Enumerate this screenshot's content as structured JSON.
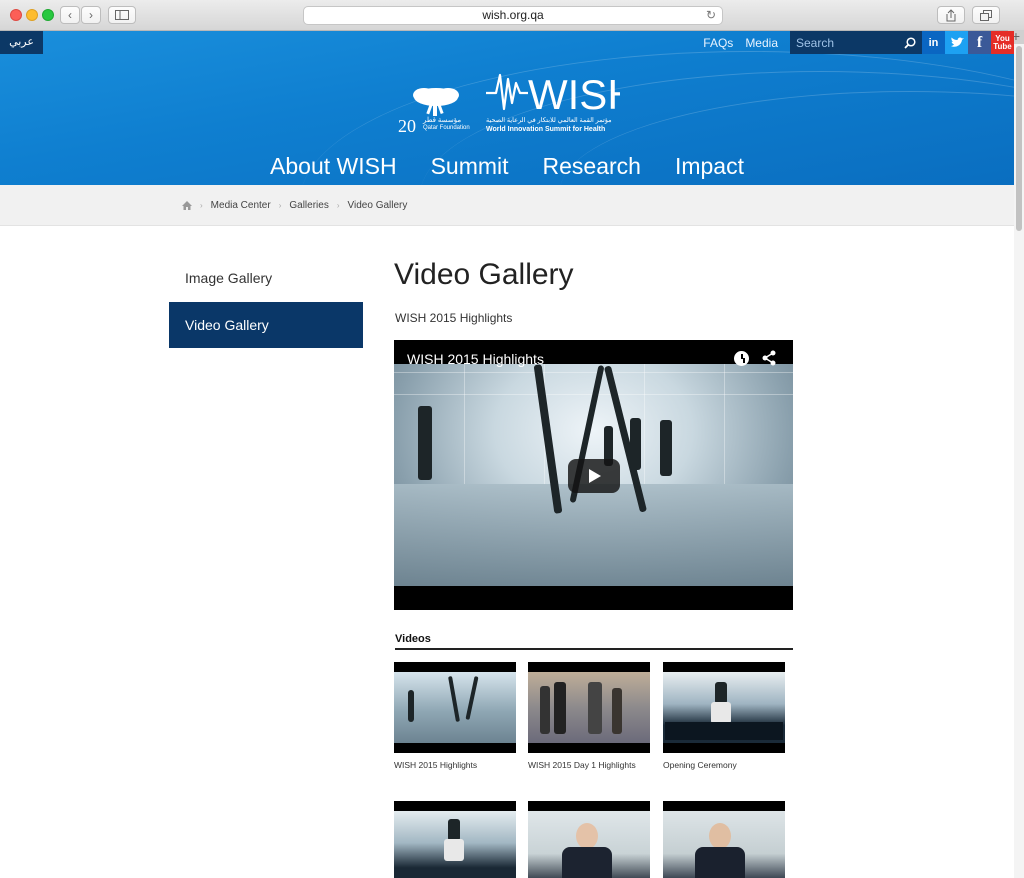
{
  "browser": {
    "url": "wish.org.qa",
    "new_tab": "+"
  },
  "header": {
    "arabic_label": "عربي",
    "top_links": [
      "FAQs",
      "Media"
    ],
    "search_placeholder": "Search",
    "social": [
      "in",
      "t",
      "f",
      "You Tube"
    ],
    "qf_number": "20",
    "qf_arabic": "مؤسسة قطر",
    "qf_english": "Qatar Foundation",
    "wish_logo": "WISH",
    "wish_arabic": "مؤتمر القمة العالمي للابتكار في الرعاية الصحية",
    "wish_english": "World Innovation Summit for Health",
    "nav": [
      "About WISH",
      "Summit",
      "Research",
      "Impact"
    ]
  },
  "breadcrumb": [
    "Media Center",
    "Galleries",
    "Video Gallery"
  ],
  "sidebar": {
    "items": [
      {
        "label": "Image Gallery",
        "active": false
      },
      {
        "label": "Video Gallery",
        "active": true
      }
    ]
  },
  "main": {
    "title": "Video Gallery",
    "subtitle": "WISH 2015 Highlights",
    "player": {
      "title": "WISH 2015 Highlights"
    },
    "videos_heading": "Videos",
    "videos": [
      {
        "caption": "WISH 2015 Highlights"
      },
      {
        "caption": "WISH 2015 Day 1 Highlights"
      },
      {
        "caption": "Opening Ceremony"
      },
      {
        "caption": ""
      },
      {
        "caption": ""
      },
      {
        "caption": ""
      }
    ]
  },
  "colors": {
    "header_blue": "#0f7fd0",
    "navy": "#0a3768",
    "linkedin": "#0a66c2",
    "twitter": "#1da1f2",
    "facebook": "#3b5998",
    "youtube": "#e52d27"
  }
}
